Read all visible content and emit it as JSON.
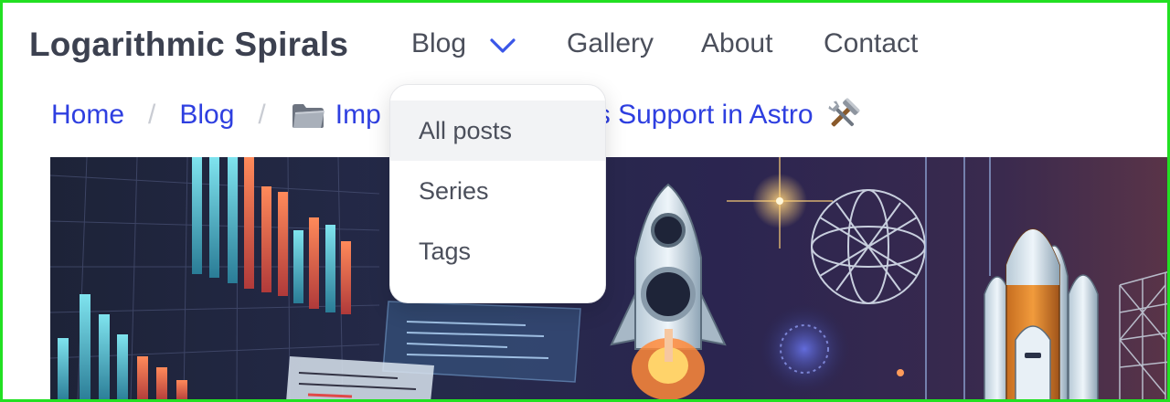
{
  "brand": {
    "name": "Logarithmic Spirals"
  },
  "nav": {
    "items": [
      {
        "label": "Blog",
        "has_dropdown": true,
        "expanded": true
      },
      {
        "label": "Gallery"
      },
      {
        "label": "About"
      },
      {
        "label": "Contact"
      }
    ]
  },
  "dropdown": {
    "items": [
      {
        "label": "All posts",
        "hovered": true
      },
      {
        "label": "Series"
      },
      {
        "label": "Tags"
      }
    ]
  },
  "breadcrumb": {
    "items": [
      {
        "label": "Home"
      },
      {
        "label": "Blog"
      }
    ],
    "separator": "/",
    "current_prefix": "Imp",
    "current_suffix": "s Support in Astro",
    "current_icon_before": "folder-icon",
    "current_icon_after": "tools-icon"
  },
  "hero": {
    "icon": "rocket-launch-illustration"
  },
  "colors": {
    "link": "#2e3fe0",
    "brand_text": "#3c4150",
    "nav_text": "#4b4f5b",
    "chevron": "#3a56e8",
    "frame": "#22e022",
    "dropdown_hover": "#f2f3f5"
  }
}
